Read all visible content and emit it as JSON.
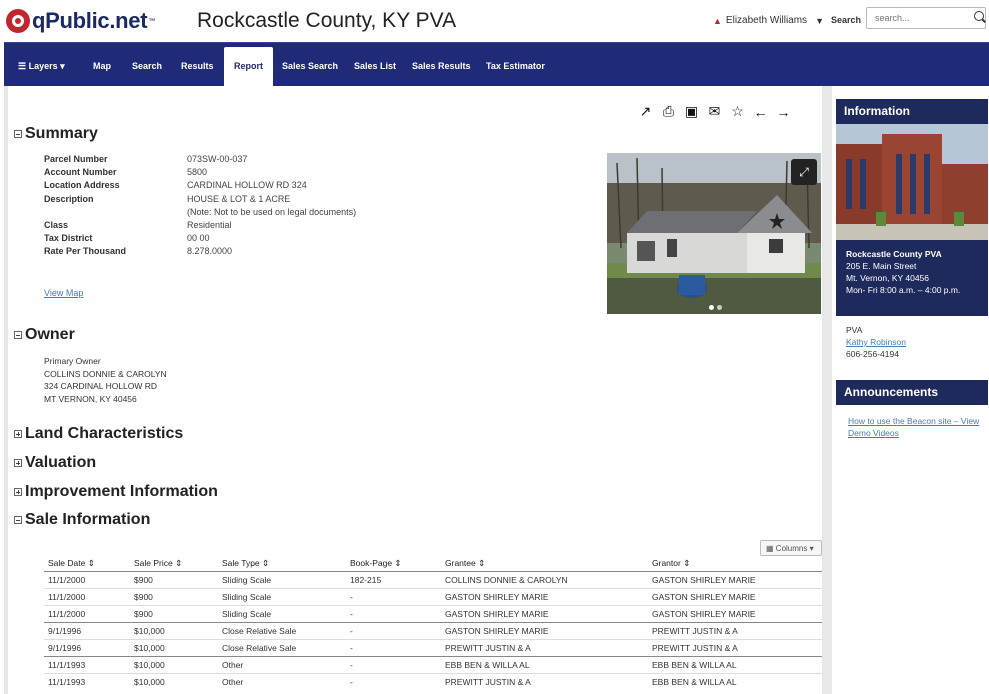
{
  "header": {
    "logo_text": "qPublic.net",
    "logo_tm": "™",
    "county_title": "Rockcastle County, KY PVA",
    "user_name": "Elizabeth Williams",
    "search_label": "Search",
    "search_placeholder": "search..."
  },
  "nav": {
    "layers": "Layers",
    "map": "Map",
    "search": "Search",
    "results": "Results",
    "report": "Report",
    "sales_search": "Sales Search",
    "sales_list": "Sales List",
    "sales_results": "Sales Results",
    "tax_estimator": "Tax Estimator"
  },
  "summary": {
    "title": "Summary",
    "fields": [
      {
        "label": "Parcel Number",
        "value": "073SW-00-037"
      },
      {
        "label": "Account Number",
        "value": "5800"
      },
      {
        "label": "Location Address",
        "value": "CARDINAL HOLLOW RD 324"
      },
      {
        "label": "Description",
        "value": "HOUSE & LOT & 1 ACRE"
      },
      {
        "label": "",
        "value": "(Note: Not to be used on legal documents)"
      },
      {
        "label": "Class",
        "value": "Residential"
      },
      {
        "label": "Tax District",
        "value": "00 00"
      },
      {
        "label": "Rate Per Thousand",
        "value": "8.278.0000"
      }
    ],
    "view_map": "View Map"
  },
  "owner": {
    "title": "Owner",
    "label": "Primary Owner",
    "lines": [
      "COLLINS DONNIE & CAROLYN",
      "324 CARDINAL HOLLOW RD",
      "MT VERNON, KY 40456"
    ]
  },
  "sections": {
    "land": "Land Characteristics",
    "valuation": "Valuation",
    "improvement": "Improvement Information",
    "sale": "Sale Information"
  },
  "sales_table": {
    "columns_label": "Columns",
    "headers": [
      "Sale Date",
      "Sale Price",
      "Sale Type",
      "Book-Page",
      "Grantee",
      "Grantor"
    ],
    "rows": [
      [
        "11/1/2000",
        "$900",
        "Sliding Scale",
        "182-215",
        "COLLINS DONNIE & CAROLYN",
        "GASTON SHIRLEY MARIE"
      ],
      [
        "11/1/2000",
        "$900",
        "Sliding Scale",
        "-",
        "GASTON SHIRLEY MARIE",
        "GASTON SHIRLEY MARIE"
      ],
      [
        "11/1/2000",
        "$900",
        "Sliding Scale",
        "-",
        "GASTON SHIRLEY MARIE",
        "GASTON SHIRLEY MARIE"
      ],
      [
        "9/1/1996",
        "$10,000",
        "Close Relative Sale",
        "-",
        "GASTON SHIRLEY MARIE",
        "PREWITT JUSTIN & A"
      ],
      [
        "9/1/1996",
        "$10,000",
        "Close Relative Sale",
        "-",
        "PREWITT JUSTIN & A",
        "PREWITT JUSTIN & A"
      ],
      [
        "11/1/1993",
        "$10,000",
        "Other",
        "-",
        "EBB BEN & WILLA AL",
        "EBB BEN & WILLA AL"
      ],
      [
        "11/1/1993",
        "$10,000",
        "Other",
        "-",
        "PREWITT JUSTIN & A",
        "EBB BEN & WILLA AL"
      ]
    ]
  },
  "sidebar": {
    "info_title": "Information",
    "office_name": "Rockcastle County PVA",
    "address1": "205 E. Main Street",
    "address2": "Mt. Vernon, KY 40456",
    "hours": "Mon- Fri 8:00 a.m. – 4:00 p.m.",
    "pva_label": "PVA",
    "pva_name": "Kathy Robinson",
    "pva_phone": "606-256-4194",
    "ann_title": "Announcements",
    "ann_link": "How to use the Beacon site – View Demo Videos"
  }
}
